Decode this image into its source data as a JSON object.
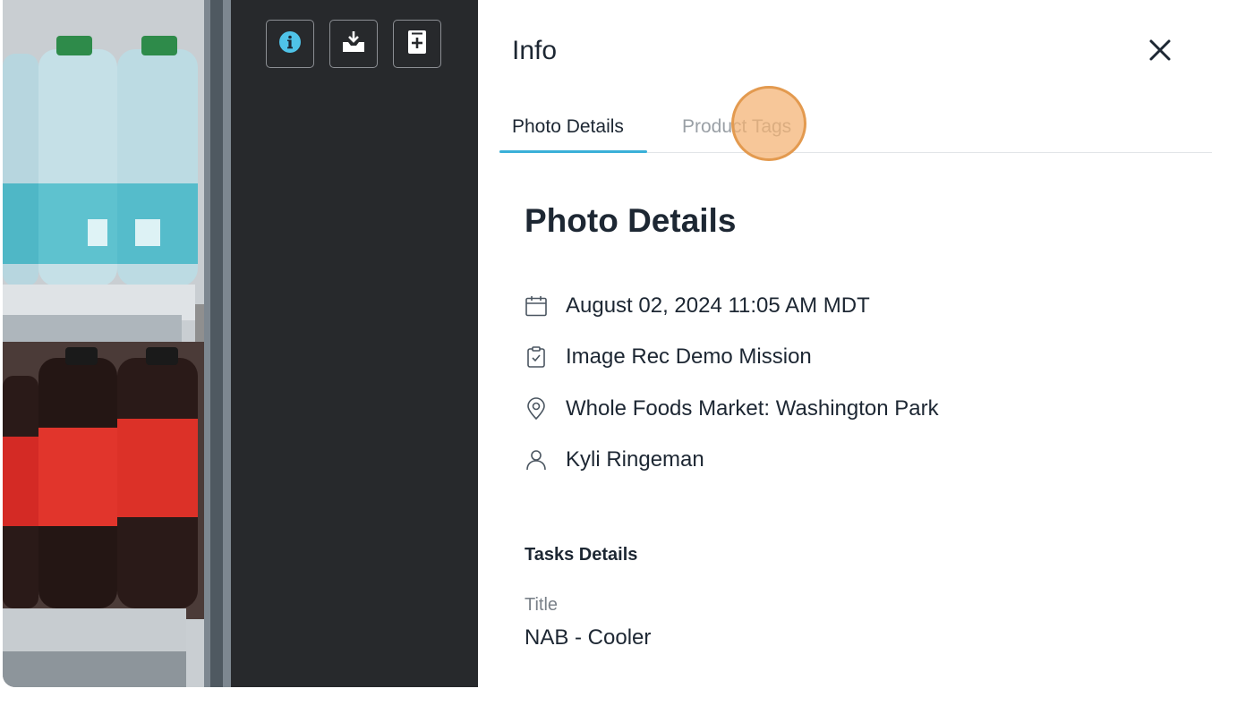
{
  "toolbar": {
    "buttons": [
      {
        "icon": "info-icon",
        "active": true
      },
      {
        "icon": "download-icon",
        "active": false
      },
      {
        "icon": "add-note-icon",
        "active": false
      }
    ]
  },
  "panel": {
    "title": "Info",
    "close_icon": "close-icon",
    "tabs": [
      {
        "label": "Photo Details",
        "active": true
      },
      {
        "label": "Product Tags",
        "active": false
      }
    ],
    "heading": "Photo Details",
    "details": [
      {
        "icon": "calendar-icon",
        "text": "August 02, 2024 11:05 AM MDT"
      },
      {
        "icon": "clipboard-check-icon",
        "text": "Image Rec Demo Mission"
      },
      {
        "icon": "location-pin-icon",
        "text": "Whole Foods Market: Washington Park"
      },
      {
        "icon": "user-icon",
        "text": "Kyli Ringeman"
      }
    ],
    "tasks_heading": "Tasks Details",
    "title_label": "Title",
    "title_value": "NAB - Cooler"
  },
  "colors": {
    "accent": "#3ab0d8",
    "dark_pane": "#27292c",
    "text": "#1d2733",
    "muted": "#9aa0a6",
    "click_marker": "#f4b171"
  }
}
